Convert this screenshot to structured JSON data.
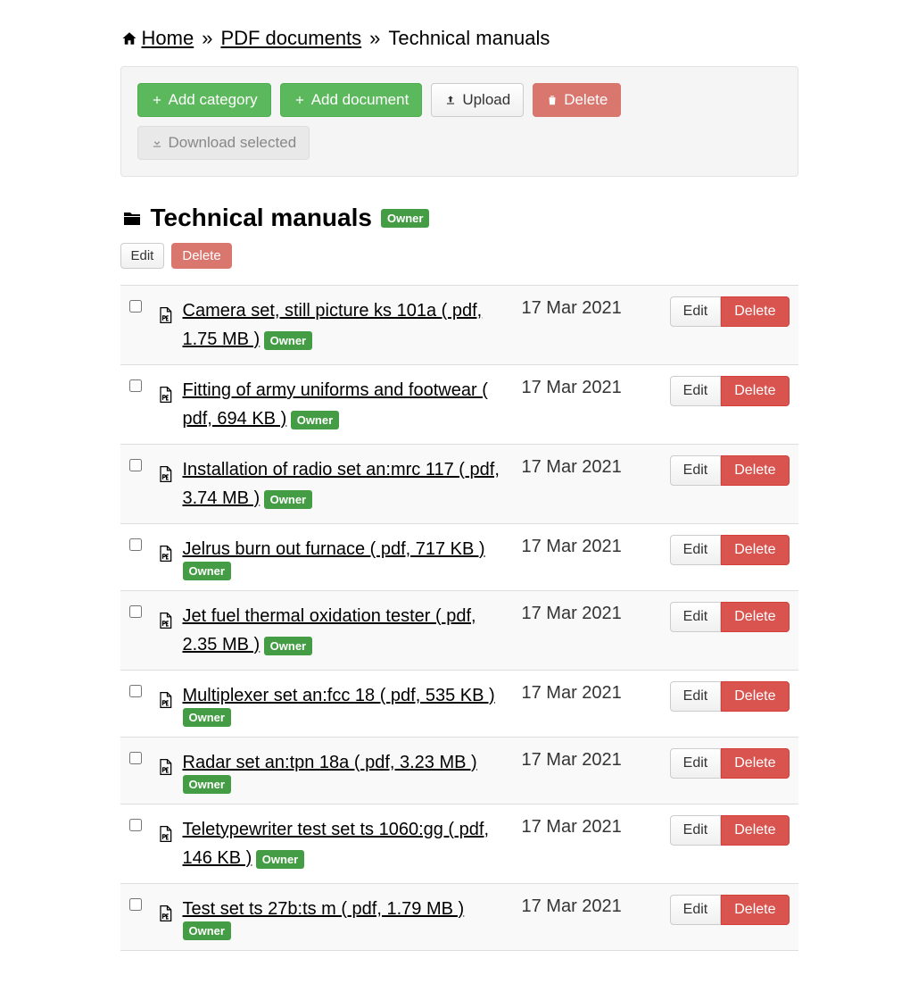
{
  "breadcrumb": {
    "home": "Home",
    "pdf": "PDF documents",
    "current": "Technical manuals"
  },
  "toolbar": {
    "add_cat": "Add category",
    "add_doc": "Add document",
    "upload": "Upload",
    "delete": "Delete",
    "download": "Download selected"
  },
  "page": {
    "title": "Technical manuals",
    "badge": "Owner",
    "edit": "Edit",
    "delete": "Delete"
  },
  "row_labels": {
    "edit": "Edit",
    "delete": "Delete",
    "badge": "Owner"
  },
  "docs": [
    {
      "title": "Camera set, still picture ks 101a ( pdf, 1.75 MB )",
      "date": "17 Mar 2021"
    },
    {
      "title": "Fitting of army uniforms and footwear ( pdf, 694 KB )",
      "date": "17 Mar 2021"
    },
    {
      "title": "Installation of radio set an:mrc 117 ( pdf, 3.74 MB )",
      "date": "17 Mar 2021"
    },
    {
      "title": "Jelrus burn out furnace ( pdf, 717 KB )",
      "date": "17 Mar 2021"
    },
    {
      "title": "Jet fuel thermal oxidation tester ( pdf, 2.35 MB )",
      "date": "17 Mar 2021"
    },
    {
      "title": "Multiplexer set an:fcc 18 ( pdf, 535 KB )",
      "date": "17 Mar 2021"
    },
    {
      "title": "Radar set an:tpn 18a ( pdf, 3.23 MB )",
      "date": "17 Mar 2021"
    },
    {
      "title": "Teletypewriter test set ts 1060:gg ( pdf, 146 KB )",
      "date": "17 Mar 2021"
    },
    {
      "title": "Test set ts 27b:ts m ( pdf, 1.79 MB )",
      "date": "17 Mar 2021"
    }
  ]
}
